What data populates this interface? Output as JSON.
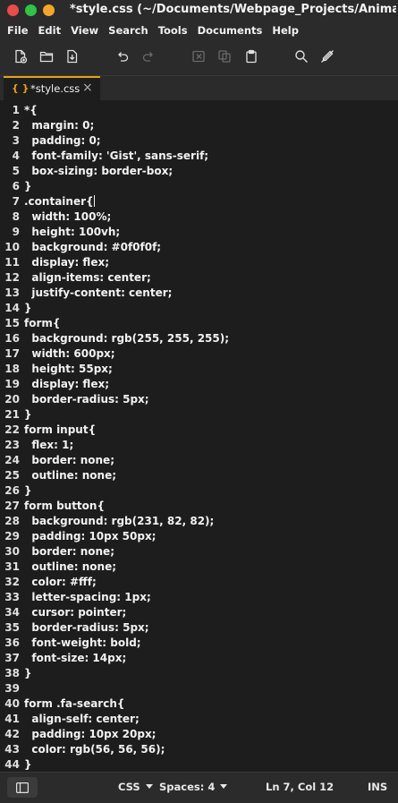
{
  "window": {
    "title": "*style.css (~/Documents/Webpage_Projects/Animated_S..."
  },
  "menu": [
    "File",
    "Edit",
    "View",
    "Search",
    "Tools",
    "Documents",
    "Help"
  ],
  "toolbar": {
    "icons": [
      "new-file-icon",
      "open-folder-icon",
      "save-icon",
      "undo-icon",
      "redo-icon",
      "cut-icon",
      "copy-icon",
      "paste-icon",
      "search-icon",
      "edit-off-icon"
    ]
  },
  "tab": {
    "icon": "{ }",
    "label": "*style.css",
    "close": "×"
  },
  "editor": {
    "lines": [
      "*{",
      "  margin: 0;",
      "  padding: 0;",
      "  font-family: 'Gist', sans-serif;",
      "  box-sizing: border-box;",
      "}",
      ".container{",
      "  width: 100%;",
      "  height: 100vh;",
      "  background: #0f0f0f;",
      "  display: flex;",
      "  align-items: center;",
      "  justify-content: center;",
      "}",
      "form{",
      "  background: rgb(255, 255, 255);",
      "  width: 600px;",
      "  height: 55px;",
      "  display: flex;",
      "  border-radius: 5px;",
      "}",
      "form input{",
      "  flex: 1;",
      "  border: none;",
      "  outline: none;",
      "}",
      "form button{",
      "  background: rgb(231, 82, 82);",
      "  padding: 10px 50px;",
      "  border: none;",
      "  outline: none;",
      "  color: #fff;",
      "  letter-spacing: 1px;",
      "  cursor: pointer;",
      "  border-radius: 5px;",
      "  font-weight: bold;",
      "  font-size: 14px;",
      "}",
      "",
      "form .fa-search{",
      "  align-self: center;",
      "  padding: 10px 20px;",
      "  color: rgb(56, 56, 56);",
      "}"
    ],
    "cursor_line": 7
  },
  "status": {
    "language": "CSS",
    "indent": "Spaces: 4",
    "position": "Ln 7, Col 12",
    "mode": "INS"
  },
  "colors": {
    "bg": "#1d1d1d",
    "chrome": "#2b2b2b",
    "accent": "#e5a50a"
  }
}
